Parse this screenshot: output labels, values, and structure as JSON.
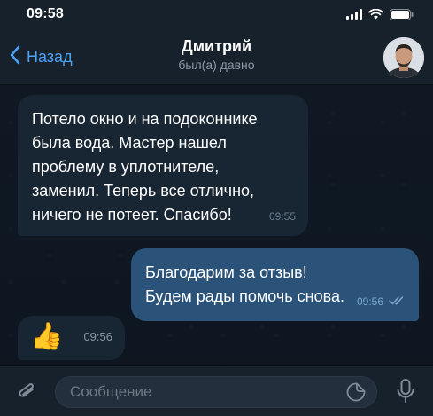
{
  "status_bar": {
    "time": "09:58",
    "icons": [
      "signal-icon",
      "wifi-icon",
      "battery-icon"
    ]
  },
  "header": {
    "back_label": "Назад",
    "title": "Дмитрий",
    "subtitle": "был(а) давно",
    "back_icon": "chevron-left-icon",
    "accent_color": "#4da3f5"
  },
  "messages": [
    {
      "direction": "incoming",
      "text": "Потело окно и на подоконнике\nбыла вода. Мастер нашел\nпроблему в уплотнителе,\nзаменил. Теперь все отлично,\nничего не потеет. Спасибо!",
      "time": "09:55"
    },
    {
      "direction": "outgoing",
      "text": "Благодарим за отзыв!\nБудем рады помочь снова.",
      "time": "09:56",
      "status": "read"
    },
    {
      "direction": "outgoing",
      "emoji": "👍",
      "time": "09:56"
    }
  ],
  "composer": {
    "placeholder": "Сообщение",
    "value": "",
    "icons": [
      "paperclip-icon",
      "sticker-icon",
      "microphone-icon"
    ]
  },
  "colors": {
    "background": "#0e1621",
    "bar": "#17212b",
    "incoming_bubble": "#182533",
    "outgoing_bubble": "#2b5278"
  }
}
